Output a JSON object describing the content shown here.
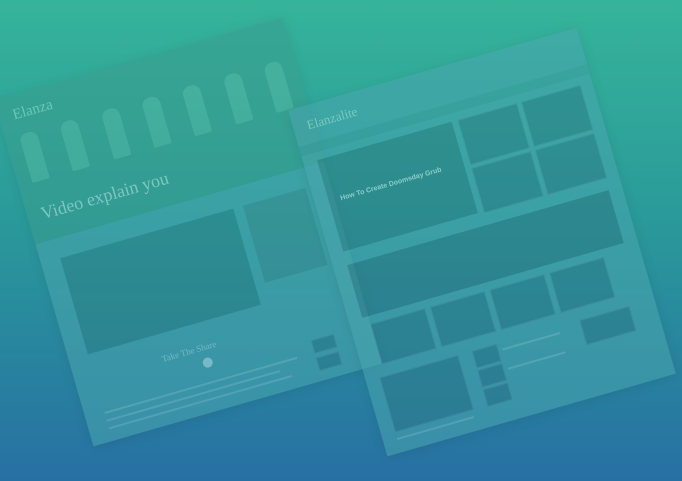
{
  "left_mockup": {
    "brand": "Elanza",
    "hero_text": "Video explain you",
    "section_title": "Take The Share"
  },
  "right_mockup": {
    "brand": "Elanzalite",
    "feature_caption": "How To Create Doomsday Grub"
  },
  "colors": {
    "gradient_top": "#36b49a",
    "gradient_bottom": "#2770a3"
  }
}
